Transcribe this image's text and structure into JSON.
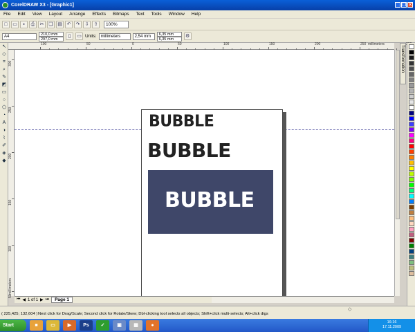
{
  "window": {
    "title": "CorelDRAW X3 - [Graphic1]"
  },
  "menu": [
    "File",
    "Edit",
    "View",
    "Layout",
    "Arrange",
    "Effects",
    "Bitmaps",
    "Text",
    "Tools",
    "Window",
    "Help"
  ],
  "toolbar": {
    "zoom": "100%"
  },
  "property_bar": {
    "paper": "A4",
    "width": "210,0 mm",
    "height": "297,0 mm",
    "units_label": "Units:",
    "units": "millimeters",
    "nudge": "2,54 mm",
    "dup_x": "6,35 mm",
    "dup_y": "6,35 mm"
  },
  "rulers": {
    "h_ticks": [
      "100",
      "50",
      "0",
      "50",
      "100",
      "150",
      "200",
      "250",
      "300"
    ],
    "h_unit": "millimeters",
    "v_ticks": [
      "300",
      "250",
      "200",
      "150",
      "100",
      "50"
    ],
    "v_unit": "millimeters"
  },
  "canvas": {
    "lines": [
      "BUBBLE",
      "BUBBLE",
      "BUBBLE"
    ]
  },
  "docker": {
    "tab": "Transformation"
  },
  "palette": [
    "#000000",
    "#1a1a1a",
    "#333333",
    "#4d4d4d",
    "#666666",
    "#808080",
    "#999999",
    "#b3b3b3",
    "#cccccc",
    "#e6e6e6",
    "#ffffff",
    "#00007f",
    "#0000ff",
    "#3f3fff",
    "#7f00ff",
    "#ff00ff",
    "#ff007f",
    "#ff0000",
    "#ff3f00",
    "#ff7f00",
    "#ffbf00",
    "#ffff00",
    "#bfff00",
    "#7fff00",
    "#00ff00",
    "#00ff7f",
    "#00ffff",
    "#007fff",
    "#7f3f00",
    "#bf7f3f",
    "#ffbf7f",
    "#ffd8c0",
    "#ff9fbf",
    "#bf5f7f",
    "#7f0000",
    "#007f00",
    "#00407f",
    "#3f7f7f",
    "#7fbf7f",
    "#bfbf7f",
    "#dfbf9f"
  ],
  "page_nav": {
    "counter": "1 of 1",
    "tab": "Page 1"
  },
  "status": {
    "coords": "( 225,425; 132,604 )",
    "hint": "Next click for Drag/Scale; Second click for Rotate/Skew; Dbl-clicking tool selects all objects; Shift+click multi-selects; Alt+click digs"
  },
  "taskbar": {
    "start": "Start",
    "time": "16:16",
    "date": "17.11.2009"
  },
  "icons": [
    "corel-app-icon",
    "minimize-icon",
    "restore-icon",
    "close-icon",
    "new-icon",
    "open-icon",
    "save-icon",
    "print-icon",
    "cut-icon",
    "copy-icon",
    "paste-icon",
    "undo-icon",
    "redo-icon",
    "import-icon",
    "export-icon"
  ]
}
